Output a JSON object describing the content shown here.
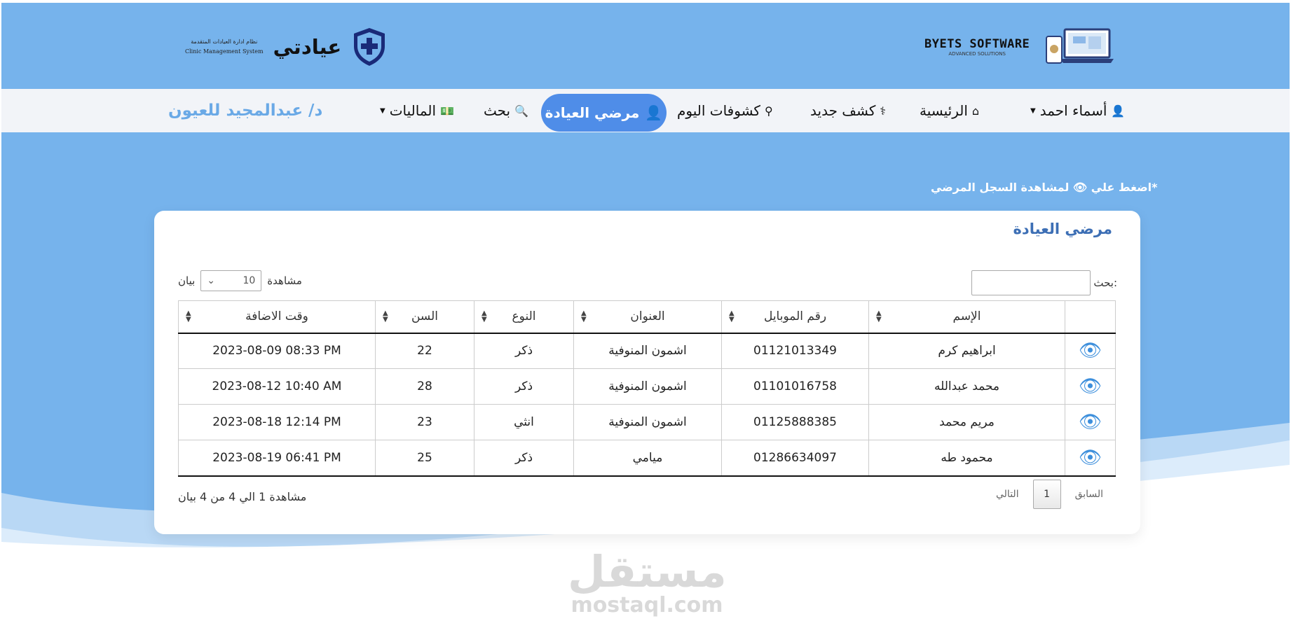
{
  "colors": {
    "brand_blue": "#76b3ec",
    "active_nav": "#4f8de8",
    "title_blue": "#3d6fb5",
    "eye_blue": "#3d8fdc"
  },
  "header": {
    "app_name": "عيادتي",
    "app_subtitle_ar": "نظام ادارة العيادات المتقدمة",
    "app_subtitle_en": "Clinic Management System",
    "company_name": "BYETS SOFTWARE",
    "company_tagline": "ADVANCED SOLUTIONS"
  },
  "nav": {
    "user": "أسماء احمد",
    "home": "الرئيسية",
    "new_exam": "كشف جديد",
    "today_exams": "كشوفات اليوم",
    "patients": "مرضي العيادة",
    "search": "بحث",
    "finance": "الماليات",
    "doctor": "د/ عبدالمجيد للعيون"
  },
  "hint": "*اضغط علي 👁 لمشاهدة السجل المرضي",
  "card": {
    "title": "مرضي العيادة",
    "search_label": "بحث:",
    "show_prefix": "مشاهدة",
    "show_value": "10",
    "show_suffix": "بيان"
  },
  "table": {
    "headers": [
      "الإسم",
      "رقم الموبايل",
      "العنوان",
      "النوع",
      "السن",
      "وقت الاضافة"
    ],
    "rows": [
      {
        "name": "ابراهيم كرم",
        "mobile": "01121013349",
        "address": "اشمون المنوفية",
        "gender": "ذكر",
        "age": "22",
        "added": "2023-08-09 08:33 PM"
      },
      {
        "name": "محمد عبدالله",
        "mobile": "01101016758",
        "address": "اشمون المنوفية",
        "gender": "ذكر",
        "age": "28",
        "added": "2023-08-12 10:40 AM"
      },
      {
        "name": "مريم محمد",
        "mobile": "01125888385",
        "address": "اشمون المنوفية",
        "gender": "انثي",
        "age": "23",
        "added": "2023-08-18 12:14 PM"
      },
      {
        "name": "محمود طه",
        "mobile": "01286634097",
        "address": "ميامي",
        "gender": "ذكر",
        "age": "25",
        "added": "2023-08-19 06:41 PM"
      }
    ]
  },
  "footer": {
    "info": "مشاهدة 1 الي 4 من 4 بيان",
    "prev": "السابق",
    "page": "1",
    "next": "التالي"
  },
  "watermark": {
    "ar": "مستقل",
    "en": "mostaql.com"
  }
}
